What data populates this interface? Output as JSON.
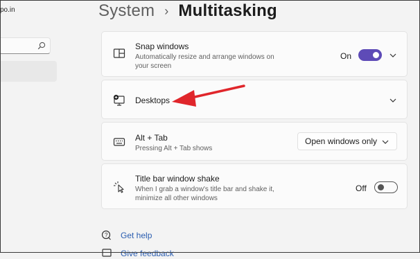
{
  "sidebar": {
    "account_text": "po.in"
  },
  "header": {
    "breadcrumb_parent": "System",
    "separator": "›",
    "current_page": "Multitasking"
  },
  "settings": {
    "snap": {
      "title": "Snap windows",
      "description_line1": "Automatically resize and arrange windows on",
      "description_line2": "your screen",
      "toggle_label": "On",
      "toggle_state": true
    },
    "desktops": {
      "title": "Desktops"
    },
    "alt_tab": {
      "title": "Alt + Tab",
      "description": "Pressing Alt + Tab shows",
      "dropdown_value": "Open windows only"
    },
    "shake": {
      "title": "Title bar window shake",
      "description_line1": "When I grab a window's title bar and shake it,",
      "description_line2": "minimize all other windows",
      "toggle_label": "Off",
      "toggle_state": false
    }
  },
  "links": {
    "get_help": "Get help",
    "give_feedback": "Give feedback"
  },
  "colors": {
    "accent": "#5e4bb7",
    "annotation_arrow": "#e0262b"
  }
}
